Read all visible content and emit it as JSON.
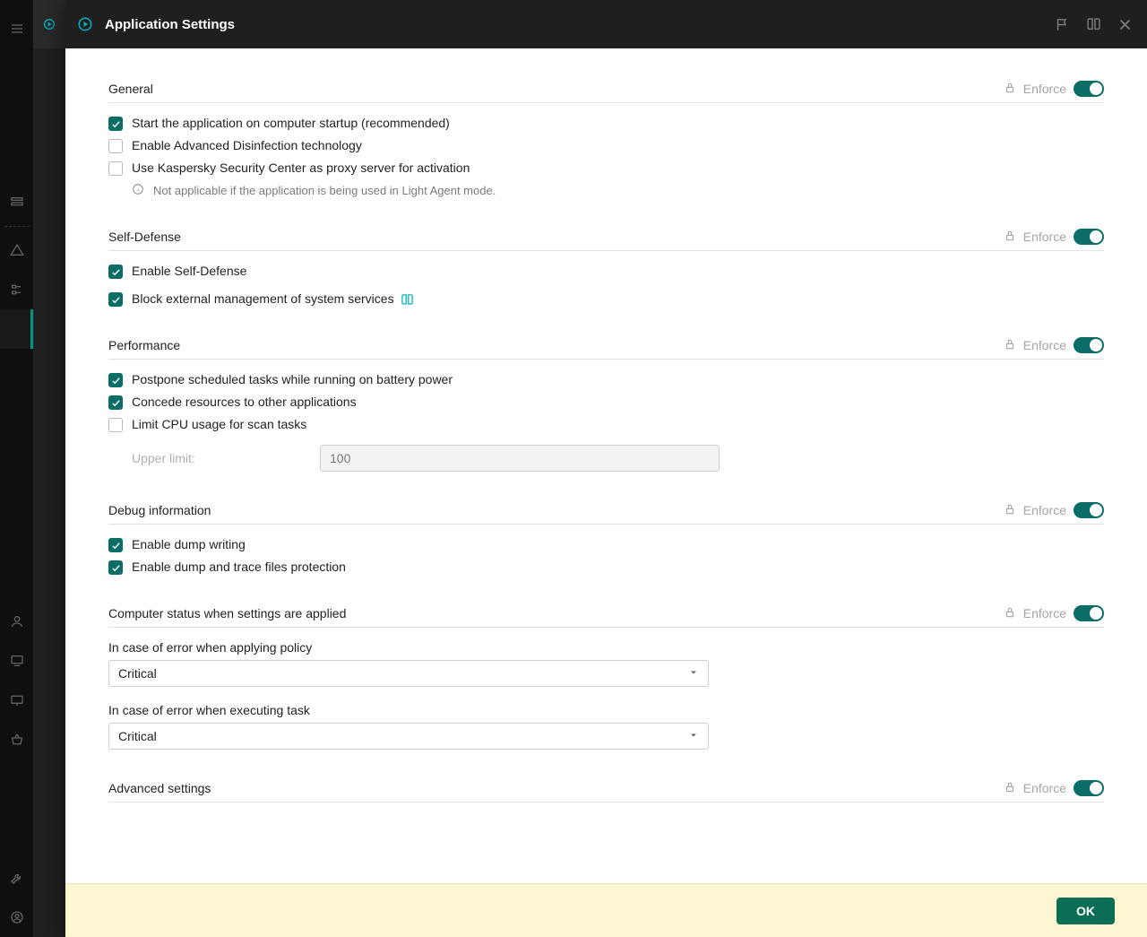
{
  "header": {
    "title": "Application Settings"
  },
  "sections": {
    "general": {
      "title": "General",
      "enforce_label": "Enforce",
      "items": {
        "startup": "Start the application on computer startup (recommended)",
        "disinfection": "Enable Advanced Disinfection technology",
        "proxy": "Use Kaspersky Security Center as proxy server for activation",
        "note": "Not applicable if the application is being used in Light Agent mode."
      }
    },
    "self_defense": {
      "title": "Self-Defense",
      "enforce_label": "Enforce",
      "items": {
        "enable": "Enable Self-Defense",
        "block_ext": "Block external management of system services"
      }
    },
    "performance": {
      "title": "Performance",
      "enforce_label": "Enforce",
      "items": {
        "battery": "Postpone scheduled tasks while running on battery power",
        "concede": "Concede resources to other applications",
        "limit_cpu": "Limit CPU usage for scan tasks",
        "upper_limit_label": "Upper limit:",
        "upper_limit_value": "100"
      }
    },
    "debug": {
      "title": "Debug information",
      "enforce_label": "Enforce",
      "items": {
        "dump": "Enable dump writing",
        "protect": "Enable dump and trace files protection"
      }
    },
    "status": {
      "title": "Computer status when settings are applied",
      "enforce_label": "Enforce",
      "policy_label": "In case of error when applying policy",
      "policy_value": "Critical",
      "task_label": "In case of error when executing task",
      "task_value": "Critical"
    },
    "advanced": {
      "title": "Advanced settings",
      "enforce_label": "Enforce"
    }
  },
  "footer": {
    "ok": "OK"
  }
}
